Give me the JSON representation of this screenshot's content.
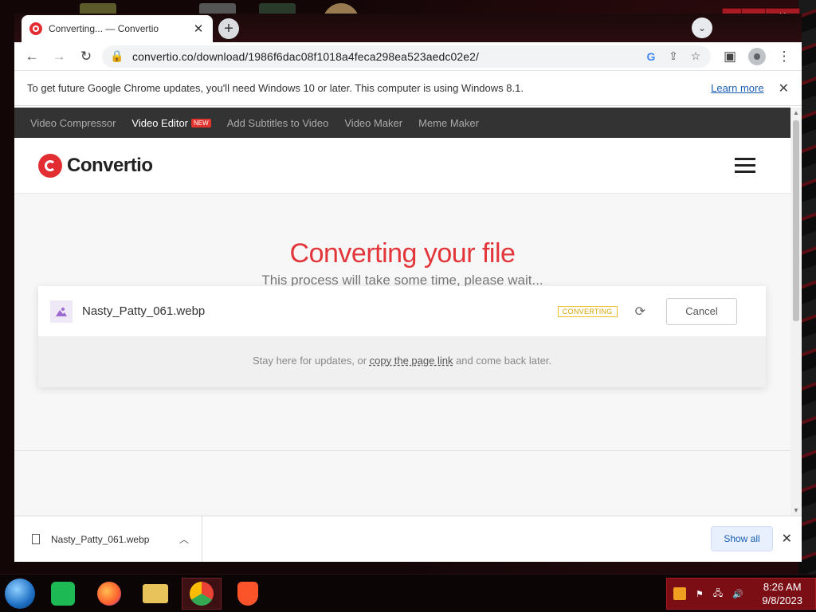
{
  "tab": {
    "title": "Converting... — Convertio"
  },
  "toolbar": {
    "url": "convertio.co/download/1986f6dac08f1018a4feca298ea523aedc02e2/"
  },
  "infobar": {
    "message": "To get future Google Chrome updates, you'll need Windows 10 or later. This computer is using Windows 8.1.",
    "link": "Learn more"
  },
  "sitenav": {
    "items": [
      "Video Compressor",
      "Video Editor",
      "Add Subtitles to Video",
      "Video Maker",
      "Meme Maker"
    ],
    "new_badge": "NEW"
  },
  "logo": {
    "text": "Convertio"
  },
  "hero": {
    "title": "Converting your file",
    "subtitle": "This process will take some time, please wait..."
  },
  "file": {
    "name": "Nasty_Patty_061.webp",
    "status": "CONVERTING",
    "cancel": "Cancel"
  },
  "stay": {
    "before": "Stay here for updates, or ",
    "link": "copy the page link",
    "after": " and come back later."
  },
  "downloads": {
    "filename": "Nasty_Patty_061.webp",
    "show_all": "Show all"
  },
  "taskbar": {
    "time": "8:26 AM",
    "date": "9/8/2023"
  },
  "colors": {
    "brand": "#e22d33",
    "tray": "#7a0e14"
  }
}
